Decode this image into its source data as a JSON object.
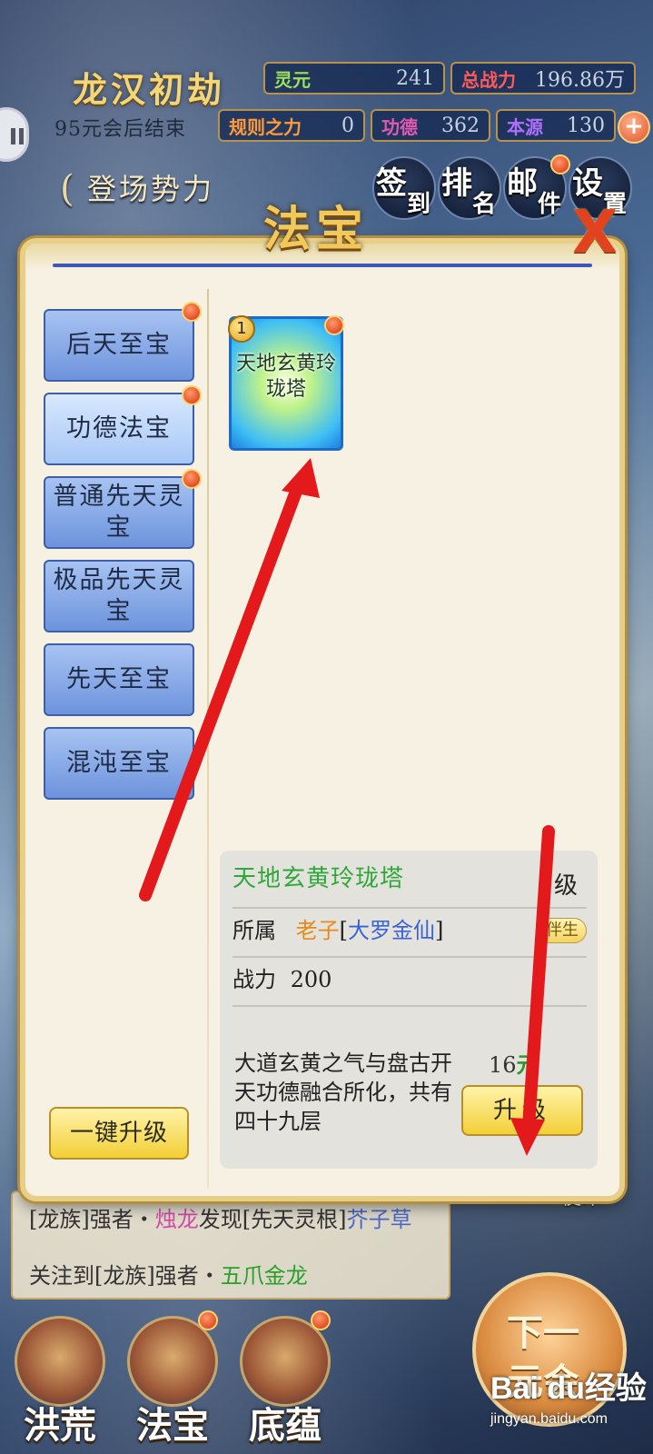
{
  "hud": {
    "era_title": "龙汉初劫",
    "era_subtitle": "95元会后结束",
    "stats": [
      {
        "label": "灵元",
        "value": "241"
      },
      {
        "label": "总战力",
        "value": "196.86万"
      },
      {
        "label": "规则之力",
        "value": "0"
      },
      {
        "label": "功德",
        "value": "362"
      },
      {
        "label": "本源",
        "value": "130"
      }
    ],
    "plus": "+",
    "faction_button": "登场势力",
    "menu": [
      {
        "char1": "签",
        "char2": "到"
      },
      {
        "char1": "排",
        "char2": "名"
      },
      {
        "char1": "邮",
        "char2": "件"
      },
      {
        "char1": "设",
        "char2": "置"
      }
    ]
  },
  "dialog": {
    "title": "法宝",
    "close": "X",
    "categories": [
      {
        "label": "后天至宝",
        "red_dot": true
      },
      {
        "label": "功德法宝",
        "red_dot": true
      },
      {
        "label": "普通先天灵宝",
        "red_dot": true
      },
      {
        "label": "极品先天灵宝",
        "red_dot": false
      },
      {
        "label": "先天至宝",
        "red_dot": false
      },
      {
        "label": "混沌至宝",
        "red_dot": false
      }
    ],
    "one_click_upgrade": "一键升级",
    "item": {
      "badge": "1",
      "name": "天地玄黄玲珑塔"
    },
    "info": {
      "name": "天地玄黄玲珑塔",
      "level_suffix": "级",
      "owner_label": "所属",
      "owner_name": "老子",
      "owner_rank": "大罗金仙",
      "bracket_open": "[",
      "bracket_close": "]",
      "companion_tag": "伴生",
      "power_label": "战力",
      "power_value": "200",
      "description": "大道玄黄之气与盘古开天功德融合所化，共有四十九层",
      "cost_value": "16",
      "cost_unit": "元",
      "upgrade_button": "升级"
    }
  },
  "background": {
    "log_line1_prefix": "[龙族]强者・",
    "log_line1_name": "烛龙",
    "log_line1_mid": "发现[先天灵根]",
    "log_line1_item": "芥子草",
    "log_line2_prefix": "关注到[龙族]强者・",
    "log_line2_name": "五爪金龙",
    "mission_tag": "使命",
    "nav": [
      "洪荒",
      "法宝",
      "底蕴"
    ],
    "next_button": [
      "下一",
      "元会"
    ]
  },
  "watermark": {
    "logo": "Bai du经验",
    "url": "jingyan.baidu.com"
  }
}
